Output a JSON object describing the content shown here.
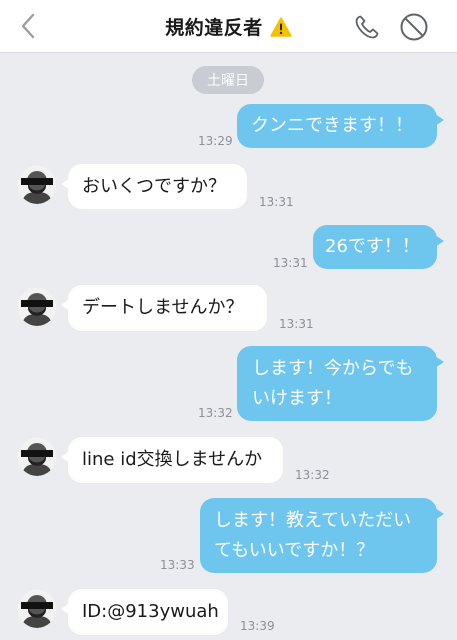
{
  "header": {
    "title": "規約違反者"
  },
  "date_separator": "土曜日",
  "avatar_label": "規 約 違 反 者",
  "messages": [
    {
      "side": "out",
      "text": "クンニできます！！",
      "time": "13:29"
    },
    {
      "side": "in",
      "text": "おいくつですか？",
      "time": "13:31"
    },
    {
      "side": "out",
      "text": "26です！！",
      "time": "13:31"
    },
    {
      "side": "in",
      "text": "デートしませんか？",
      "time": "13:31"
    },
    {
      "side": "out",
      "line1": "します！今からでも",
      "line2": "いけます！",
      "time": "13:32"
    },
    {
      "side": "in",
      "text": "line id交換しませんか",
      "time": "13:32"
    },
    {
      "side": "out",
      "line1": "します！教えていただい",
      "line2": "てもいいですか！？",
      "time": "13:33"
    },
    {
      "side": "in",
      "text": "ID:@913ywuah",
      "time": "13:39"
    }
  ],
  "colors": {
    "outgoing_bubble": "#6ec6ee",
    "incoming_bubble": "#ffffff",
    "background": "#eaecef",
    "warning": "#f2c200"
  },
  "icons": {
    "back": "chevron-left-icon",
    "warning": "warning-icon",
    "call": "phone-icon",
    "block": "block-icon"
  }
}
